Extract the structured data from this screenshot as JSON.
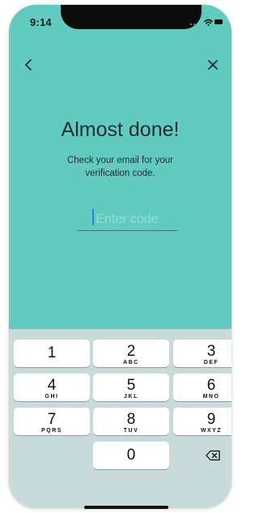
{
  "status_bar": {
    "time": "9:14"
  },
  "nav": {
    "back_icon": "chevron-left-icon",
    "close_icon": "close-icon"
  },
  "content": {
    "title": "Almost done!",
    "subtitle": "Check your email for your verification code.",
    "code_field": {
      "placeholder": "Enter code",
      "value": ""
    }
  },
  "keyboard": {
    "keys": [
      {
        "digit": "1",
        "letters": ""
      },
      {
        "digit": "2",
        "letters": "ABC"
      },
      {
        "digit": "3",
        "letters": "DEF"
      },
      {
        "digit": "4",
        "letters": "GHI"
      },
      {
        "digit": "5",
        "letters": "JKL"
      },
      {
        "digit": "6",
        "letters": "MNO"
      },
      {
        "digit": "7",
        "letters": "PQRS"
      },
      {
        "digit": "8",
        "letters": "TUV"
      },
      {
        "digit": "9",
        "letters": "WXYZ"
      },
      {
        "digit": "0",
        "letters": ""
      }
    ],
    "delete_icon": "backspace-icon"
  },
  "colors": {
    "background": "#62cbbf",
    "keyboard": "#c9dadb",
    "text": "#1d2d33",
    "placeholder": "#8fe0d6"
  }
}
